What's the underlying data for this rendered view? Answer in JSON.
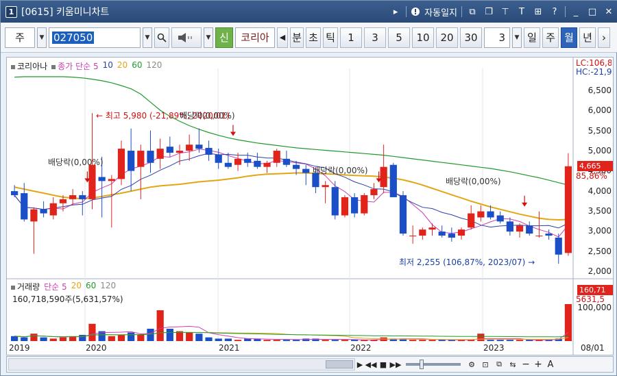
{
  "window": {
    "title": "[0615] 키움미니차트",
    "app_icon_text": "1",
    "title_tools": {
      "auto_save_label": "자동일지"
    }
  },
  "toolbar": {
    "type_select": "주",
    "code_value": "027050",
    "new_label": "신",
    "stock_name": "코리아",
    "period_buttons": [
      "분",
      "초",
      "틱"
    ],
    "interval_buttons": [
      "1",
      "3",
      "5",
      "10",
      "20",
      "30"
    ],
    "count_value": "3",
    "unit_buttons": [
      "일",
      "주",
      "월",
      "년"
    ],
    "active_unit": "월"
  },
  "price_panel": {
    "legend_name": "코리아나",
    "legend_ma": "종가 단순",
    "ma_periods": [
      "5",
      "10",
      "20",
      "60",
      "120"
    ],
    "ma_colors": [
      "#cc3fb0",
      "#2b3fa8",
      "#e3a613",
      "#1f9a2a",
      "#8a8a8a"
    ],
    "y_ticks": [
      "6,500",
      "6,000",
      "5,500",
      "5,000",
      "4,500",
      "4,000",
      "3,500",
      "3,000",
      "2,500",
      "2,000"
    ],
    "lc_label": "LC:106,8",
    "hc_label": "HC:-21,9",
    "current_price": "4,665",
    "change_pct": "85,86%",
    "annotations": {
      "high": "최고 5,980 (-21,89%, 2020/01)",
      "low": "최저 2,255 (106,87%, 2023/07)",
      "dividend_1": "배당락(0,00%)",
      "dividend_2": "배당락(0,00%)",
      "dividend_3": "배당락(0,00%)",
      "dividend_4": "배당락(0,00%)"
    }
  },
  "volume_panel": {
    "legend_name": "거래량",
    "legend_ma": "단순",
    "ma_periods": [
      "5",
      "20",
      "60",
      "120"
    ],
    "volume_info": "160,718,590주(5,631,57%)",
    "current_volume": "160,71",
    "volume_pct": "5631,5",
    "y_tick": "100,000"
  },
  "x_axis": {
    "labels": [
      "2019",
      "2020",
      "2021",
      "2022",
      "2023",
      "08/01"
    ]
  },
  "colors": {
    "up": "#e0241b",
    "down": "#1a4fc7",
    "ma5": "#cc3fb0",
    "ma10": "#2b3fa8",
    "ma20": "#e3a613",
    "ma60": "#1f9a2a",
    "ma120": "#8a8a8a"
  },
  "chart_data": {
    "type": "candlestick",
    "unit": "month",
    "candles": [
      {
        "o": 4050,
        "h": 4200,
        "l": 3900,
        "c": 3950
      },
      {
        "o": 4000,
        "h": 4250,
        "l": 3300,
        "c": 3350
      },
      {
        "o": 3300,
        "h": 3650,
        "l": 2500,
        "c": 3600
      },
      {
        "o": 3600,
        "h": 3800,
        "l": 3400,
        "c": 3500
      },
      {
        "o": 3450,
        "h": 3900,
        "l": 3350,
        "c": 3750
      },
      {
        "o": 3750,
        "h": 3950,
        "l": 3550,
        "c": 3850
      },
      {
        "o": 3850,
        "h": 4100,
        "l": 3700,
        "c": 3950
      },
      {
        "o": 3950,
        "h": 4050,
        "l": 3450,
        "c": 3850
      },
      {
        "o": 3850,
        "h": 5980,
        "l": 3600,
        "c": 4700
      },
      {
        "o": 4400,
        "h": 4900,
        "l": 3400,
        "c": 4300
      },
      {
        "o": 4300,
        "h": 4450,
        "l": 3150,
        "c": 4350
      },
      {
        "o": 4350,
        "h": 5300,
        "l": 4200,
        "c": 5100
      },
      {
        "o": 5050,
        "h": 5600,
        "l": 4050,
        "c": 4550
      },
      {
        "o": 4650,
        "h": 5200,
        "l": 3850,
        "c": 5050
      },
      {
        "o": 5050,
        "h": 5550,
        "l": 4500,
        "c": 4750
      },
      {
        "o": 4850,
        "h": 5350,
        "l": 4600,
        "c": 5100
      },
      {
        "o": 5150,
        "h": 5400,
        "l": 4900,
        "c": 5000
      },
      {
        "o": 5000,
        "h": 5200,
        "l": 4700,
        "c": 5050
      },
      {
        "o": 5050,
        "h": 5450,
        "l": 4800,
        "c": 5200
      },
      {
        "o": 5200,
        "h": 5600,
        "l": 5000,
        "c": 5100
      },
      {
        "o": 5120,
        "h": 5300,
        "l": 4800,
        "c": 4950
      },
      {
        "o": 4950,
        "h": 5100,
        "l": 4600,
        "c": 4750
      },
      {
        "o": 4750,
        "h": 5000,
        "l": 4600,
        "c": 4650
      },
      {
        "o": 4700,
        "h": 5000,
        "l": 4550,
        "c": 4850
      },
      {
        "o": 4850,
        "h": 5000,
        "l": 4650,
        "c": 4750
      },
      {
        "o": 4800,
        "h": 5000,
        "l": 4600,
        "c": 4650
      },
      {
        "o": 4650,
        "h": 4800,
        "l": 4500,
        "c": 4750
      },
      {
        "o": 4750,
        "h": 5100,
        "l": 4650,
        "c": 5050
      },
      {
        "o": 4850,
        "h": 5050,
        "l": 4650,
        "c": 4700
      },
      {
        "o": 4700,
        "h": 4800,
        "l": 4450,
        "c": 4600
      },
      {
        "o": 4600,
        "h": 4700,
        "l": 4200,
        "c": 4500
      },
      {
        "o": 4500,
        "h": 4600,
        "l": 4000,
        "c": 4150
      },
      {
        "o": 4150,
        "h": 4300,
        "l": 3750,
        "c": 4200
      },
      {
        "o": 4150,
        "h": 4300,
        "l": 3350,
        "c": 3450
      },
      {
        "o": 3450,
        "h": 3950,
        "l": 3400,
        "c": 3900
      },
      {
        "o": 3900,
        "h": 4000,
        "l": 3400,
        "c": 3500
      },
      {
        "o": 3500,
        "h": 4000,
        "l": 3450,
        "c": 3950
      },
      {
        "o": 3950,
        "h": 4250,
        "l": 3850,
        "c": 4100
      },
      {
        "o": 4150,
        "h": 5200,
        "l": 4000,
        "c": 4650
      },
      {
        "o": 4700,
        "h": 4750,
        "l": 3900,
        "c": 3900
      },
      {
        "o": 3950,
        "h": 4050,
        "l": 2950,
        "c": 3000
      },
      {
        "o": 2950,
        "h": 3200,
        "l": 2750,
        "c": 2950
      },
      {
        "o": 2950,
        "h": 3150,
        "l": 2850,
        "c": 3100
      },
      {
        "o": 3100,
        "h": 3250,
        "l": 2950,
        "c": 3150
      },
      {
        "o": 3050,
        "h": 3200,
        "l": 2900,
        "c": 2950
      },
      {
        "o": 3000,
        "h": 3150,
        "l": 2800,
        "c": 2900
      },
      {
        "o": 2950,
        "h": 3150,
        "l": 2850,
        "c": 3100
      },
      {
        "o": 3150,
        "h": 3700,
        "l": 3100,
        "c": 3500
      },
      {
        "o": 3400,
        "h": 3700,
        "l": 3300,
        "c": 3550
      },
      {
        "o": 3550,
        "h": 3700,
        "l": 3350,
        "c": 3400
      },
      {
        "o": 3450,
        "h": 3550,
        "l": 3250,
        "c": 3300
      },
      {
        "o": 3300,
        "h": 3400,
        "l": 2950,
        "c": 3050
      },
      {
        "o": 3050,
        "h": 3250,
        "l": 2900,
        "c": 3200
      },
      {
        "o": 3200,
        "h": 3300,
        "l": 2950,
        "c": 3000
      },
      {
        "o": 2950,
        "h": 3550,
        "l": 2900,
        "c": 2950
      },
      {
        "o": 3000,
        "h": 3100,
        "l": 2850,
        "c": 2950
      },
      {
        "o": 2900,
        "h": 3000,
        "l": 2255,
        "c": 2480
      },
      {
        "o": 2520,
        "h": 4990,
        "l": 2450,
        "c": 4665
      }
    ],
    "volume": [
      4,
      3,
      6,
      3,
      2,
      3,
      4,
      5,
      14,
      8,
      4,
      5,
      7,
      5,
      10,
      25,
      10,
      8,
      7,
      6,
      3,
      2,
      2,
      1,
      2,
      2,
      1,
      1,
      1,
      1,
      2,
      2,
      1,
      1,
      1,
      1,
      1,
      1,
      3,
      2,
      2,
      1,
      1,
      1,
      1,
      1,
      1,
      1,
      6,
      1,
      1,
      1,
      1,
      1,
      1,
      1,
      2,
      30
    ],
    "ma_lines": {
      "ma20": [
        4150,
        4100,
        4050,
        4000,
        3950,
        3900,
        3880,
        3860,
        3880,
        3920,
        3960,
        4000,
        4050,
        4100,
        4150,
        4180,
        4200,
        4220,
        4250,
        4280,
        4300,
        4320,
        4350,
        4380,
        4420,
        4450,
        4470,
        4480,
        4490,
        4500,
        4500,
        4490,
        4480,
        4470,
        4450,
        4440,
        4430,
        4420,
        4400,
        4370,
        4330,
        4270,
        4200,
        4120,
        4040,
        3960,
        3880,
        3800,
        3730,
        3660,
        3600,
        3540,
        3480,
        3430,
        3380,
        3350,
        3340,
        3350
      ],
      "ma60": [
        6870,
        6880,
        6880,
        6880,
        6880,
        6880,
        6870,
        6850,
        6820,
        6780,
        6730,
        6660,
        6580,
        6450,
        6250,
        6050,
        5900,
        5780,
        5670,
        5580,
        5500,
        5430,
        5370,
        5320,
        5280,
        5240,
        5210,
        5180,
        5150,
        5120,
        5100,
        5080,
        5060,
        5040,
        5020,
        5000,
        4980,
        4960,
        4940,
        4910,
        4880,
        4850,
        4820,
        4790,
        4760,
        4730,
        4700,
        4670,
        4640,
        4610,
        4570,
        4530,
        4480,
        4430,
        4380,
        4320,
        4260,
        4200
      ]
    }
  }
}
